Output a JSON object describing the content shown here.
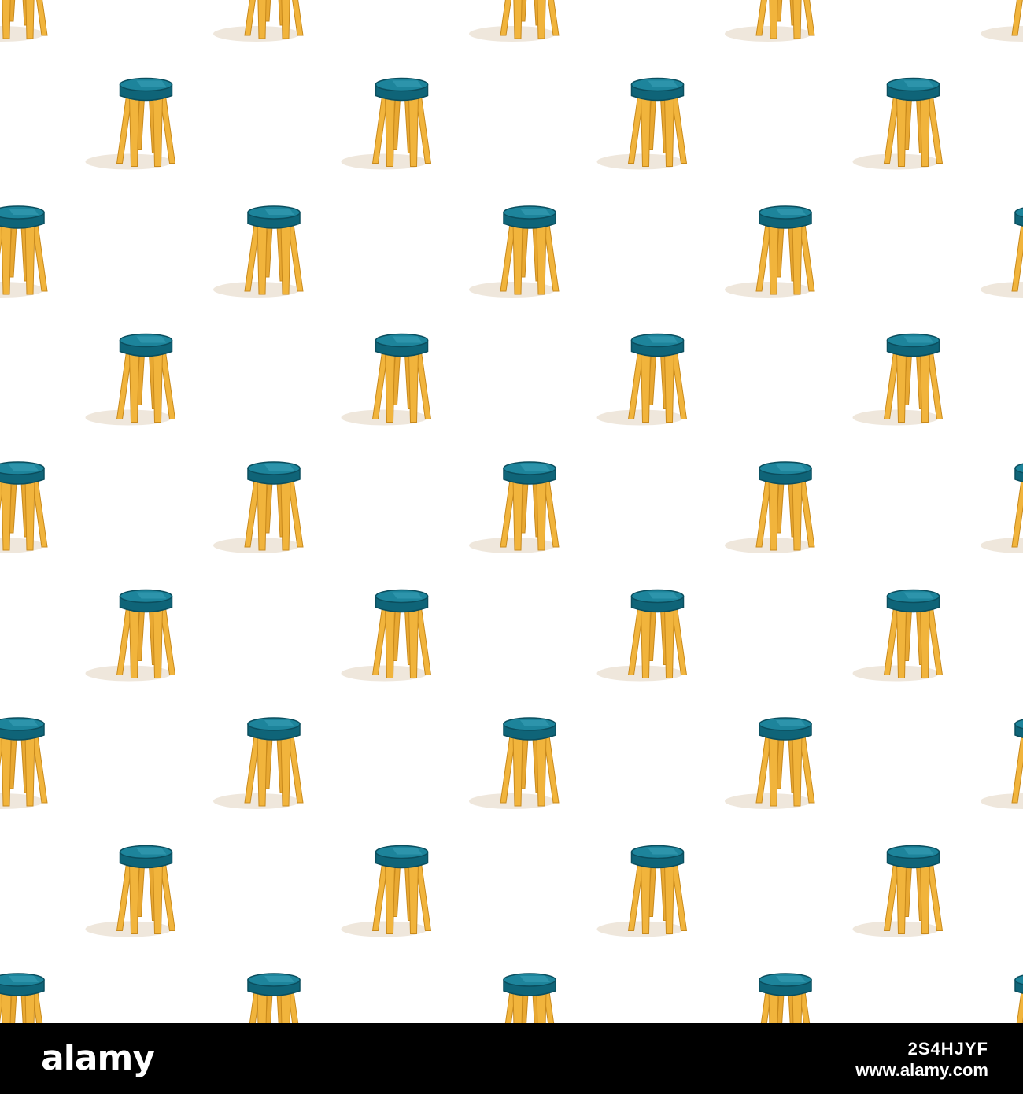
{
  "pattern": {
    "motif": "stool",
    "colors": {
      "background": "#ffffff",
      "seat_side": "#0f6478",
      "seat_top": "#1d849b",
      "seat_highlight": "#3aa3b8",
      "seat_outline": "#0b4e5e",
      "leg": "#f1b43c",
      "leg_shade": "#c98a1c",
      "shadow": "#efe7dc"
    }
  },
  "footer": {
    "logo_text": "alamy",
    "image_id": "2S4HJYF",
    "url": "www.alamy.com",
    "background": "#000000",
    "text_color": "#ffffff"
  }
}
